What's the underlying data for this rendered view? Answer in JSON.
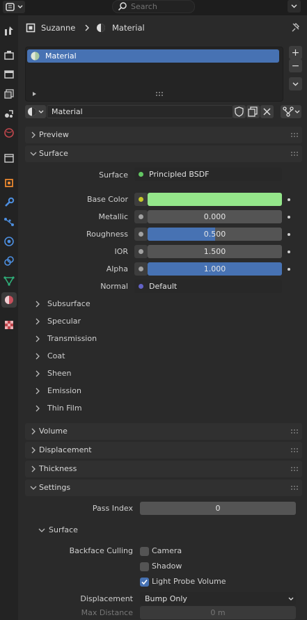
{
  "topbar": {
    "search_placeholder": "Search"
  },
  "breadcrumb": {
    "object": "Suzanne",
    "material": "Material"
  },
  "material_slots": [
    {
      "label": "Material"
    }
  ],
  "slot_buttons": {
    "add": "+",
    "remove": "−"
  },
  "datablock": {
    "name": "Material"
  },
  "panels": {
    "preview": "Preview",
    "surface": "Surface",
    "volume": "Volume",
    "displacement": "Displacement",
    "thickness": "Thickness",
    "settings": "Settings"
  },
  "surface": {
    "shader_label": "Surface",
    "shader_value": "Principled BSDF",
    "base_color_label": "Base Color",
    "base_color_hex": "#94e68a",
    "metallic_label": "Metallic",
    "metallic_value": "0.000",
    "metallic_fraction": 0.0,
    "roughness_label": "Roughness",
    "roughness_value": "0.500",
    "roughness_fraction": 0.5,
    "ior_label": "IOR",
    "ior_value": "1.500",
    "alpha_label": "Alpha",
    "alpha_value": "1.000",
    "alpha_fraction": 1.0,
    "normal_label": "Normal",
    "normal_value": "Default",
    "subpanels": [
      "Subsurface",
      "Specular",
      "Transmission",
      "Coat",
      "Sheen",
      "Emission",
      "Thin Film"
    ]
  },
  "settings": {
    "pass_index_label": "Pass Index",
    "pass_index_value": "0",
    "surface_sub": "Surface",
    "backface_label": "Backface Culling",
    "camera_label": "Camera",
    "shadow_label": "Shadow",
    "light_probe_label": "Light Probe Volume",
    "displacement_label": "Displacement",
    "displacement_value": "Bump Only",
    "max_distance_label": "Max Distance",
    "max_distance_value": "0 m"
  },
  "colors": {
    "accent": "#4772b3",
    "socket_gray": "#a1a1a1",
    "socket_yellow": "#c7c729",
    "socket_green": "#63c763",
    "socket_blue": "#6363c7"
  },
  "tabs": [
    "tool",
    "render",
    "output",
    "view-layer",
    "scene",
    "world",
    "collection",
    "object",
    "modifiers",
    "particles",
    "physics",
    "constraints",
    "data",
    "material",
    "texture"
  ]
}
